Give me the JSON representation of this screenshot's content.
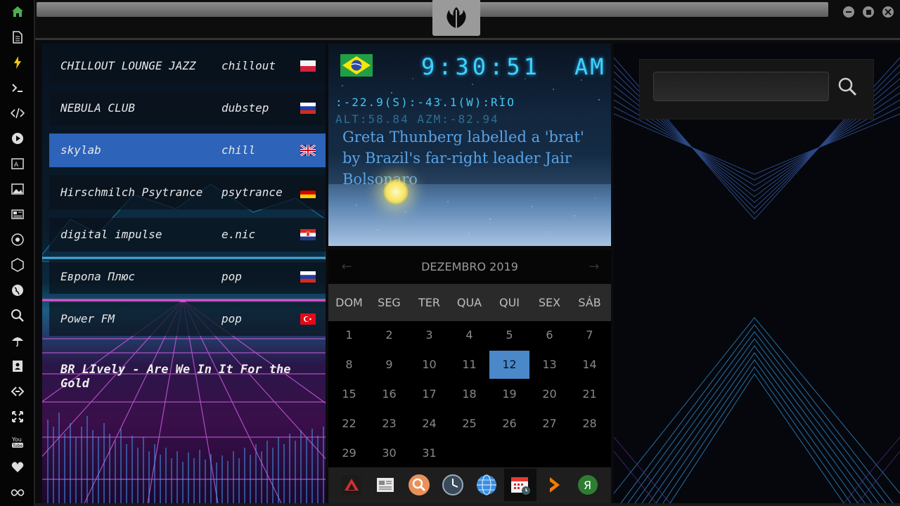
{
  "dock": {
    "items": [
      {
        "name": "home",
        "icon": "home-icon",
        "color": "#4caf50"
      },
      {
        "name": "document",
        "icon": "document-icon"
      },
      {
        "name": "flash",
        "icon": "lightning-icon",
        "color": "#f5c518"
      },
      {
        "name": "terminal",
        "icon": "terminal-icon"
      },
      {
        "name": "code",
        "icon": "code-icon"
      },
      {
        "name": "play",
        "icon": "play-icon"
      },
      {
        "name": "translate",
        "icon": "translate-icon"
      },
      {
        "name": "images",
        "icon": "image-icon"
      },
      {
        "name": "news",
        "icon": "newspaper-icon"
      },
      {
        "name": "rebel",
        "icon": "rebel-icon"
      },
      {
        "name": "hexagon",
        "icon": "hexagon-icon"
      },
      {
        "name": "globe",
        "icon": "globe-icon"
      },
      {
        "name": "search",
        "icon": "search-icon"
      },
      {
        "name": "weather",
        "icon": "umbrella-icon"
      },
      {
        "name": "contacts",
        "icon": "contact-book-icon"
      },
      {
        "name": "link",
        "icon": "link-icon"
      },
      {
        "name": "fullscreen",
        "icon": "expand-icon"
      },
      {
        "name": "youtube",
        "icon": "youtube-icon"
      },
      {
        "name": "favorites",
        "icon": "heart-icon"
      },
      {
        "name": "infinity",
        "icon": "infinity-icon"
      }
    ]
  },
  "topbar": {
    "emblem_icon": "rebel-alliance-icon"
  },
  "radio": {
    "stations": [
      {
        "name": "CHILLOUT LOUNGE JAZZ",
        "genre": "chillout",
        "flag": "poland"
      },
      {
        "name": "NEBULA CLUB",
        "genre": "dubstep",
        "flag": "russia"
      },
      {
        "name": "skylab",
        "genre": "chill",
        "flag": "uk",
        "active": true
      },
      {
        "name": "Hirschmilch Psytrance",
        "genre": "psytrance",
        "flag": "germany"
      },
      {
        "name": "digital impulse",
        "genre": "e.nic",
        "flag": "croatia"
      },
      {
        "name": "Европа Плюс",
        "genre": "pop",
        "flag": "russia"
      },
      {
        "name": "Power FM",
        "genre": "pop",
        "flag": "turkey"
      }
    ],
    "now_playing": "BR LIvely - Are We In It For the Gold"
  },
  "clock": {
    "flag": "brazil",
    "time": "9:30:51",
    "ampm": "AM",
    "coords": ":-22.9(S):-43.1(W):RIO",
    "alt_azm": "ALT:58.84 AZM:-82.94",
    "headline": "Greta Thunberg labelled a 'brat' by Brazil's far-right leader Jair Bolsonaro"
  },
  "calendar": {
    "month": "DEZEMBRO 2019",
    "prev": "←",
    "next": "→",
    "weekdays": [
      "DOM",
      "SEG",
      "TER",
      "QUA",
      "QUI",
      "SEX",
      "SÁB"
    ],
    "today": 12,
    "days": 31,
    "first_weekday": 0
  },
  "appbar": {
    "apps": [
      "delta-icon",
      "news-icon",
      "search-icon",
      "clock-icon",
      "globe-icon",
      "calendar-icon",
      "arrow-icon",
      "yandex-icon"
    ],
    "active": "calendar-icon"
  },
  "search": {
    "placeholder": "",
    "value": ""
  },
  "colors": {
    "accent": "#3fd2ff",
    "active_station": "#2d63b8",
    "today": "#4a88c9"
  }
}
